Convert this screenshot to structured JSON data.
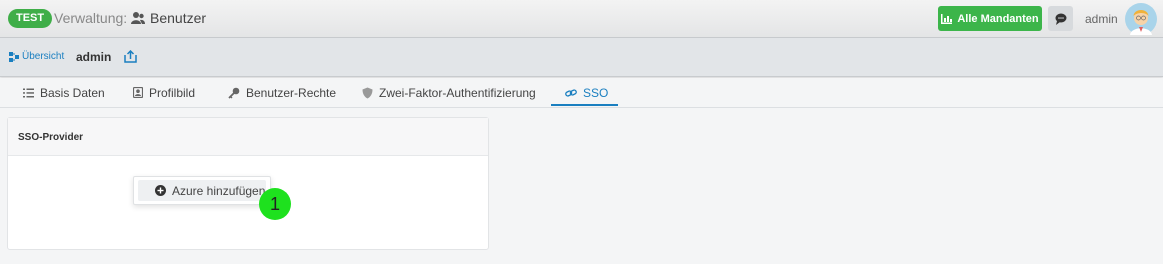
{
  "header": {
    "env_badge": "TEST",
    "section": "Verwaltung:",
    "page": "Benutzer",
    "mandanten_button": "Alle Mandanten",
    "user_name": "admin"
  },
  "subheader": {
    "overview_label": "Übersicht",
    "record_title": "admin"
  },
  "tabs": [
    {
      "label": "Basis Daten",
      "icon": "list-icon"
    },
    {
      "label": "Profilbild",
      "icon": "portrait-icon"
    },
    {
      "label": "Benutzer-Rechte",
      "icon": "key-icon"
    },
    {
      "label": "Zwei-Faktor-Authentifizierung",
      "icon": "shield-icon"
    },
    {
      "label": "SSO",
      "icon": "link-icon",
      "active": true
    }
  ],
  "panel": {
    "title": "SSO-Provider",
    "menu_item": "Azure hinzufügen"
  },
  "marker": "1",
  "colors": {
    "accent_blue": "#1a7fc0",
    "brand_green": "#3cb54a",
    "marker_green": "#1ee11e"
  }
}
